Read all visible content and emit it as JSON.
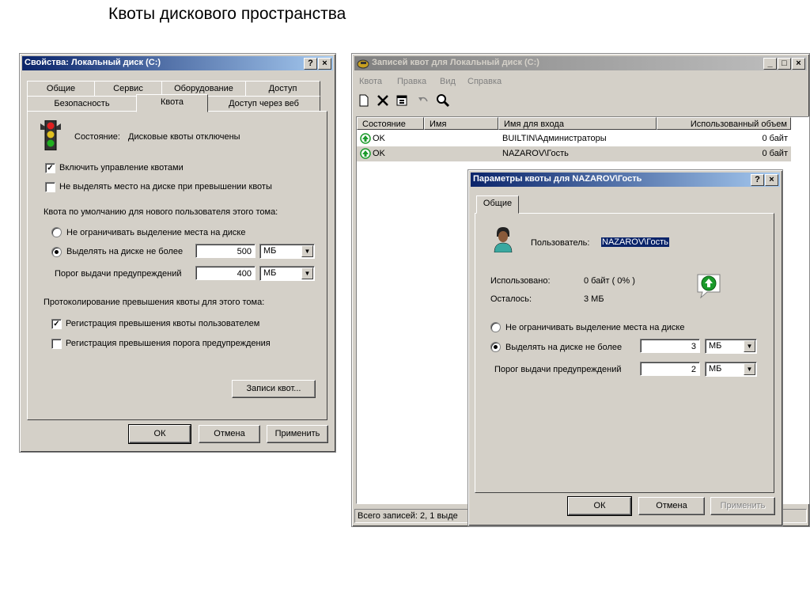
{
  "slide_title": "Квоты дискового пространства",
  "props": {
    "title": "Свойства: Локальный диск (C:)",
    "help_btn": "?",
    "close_btn": "×",
    "tabs_row1": [
      "Общие",
      "Сервис",
      "Оборудование",
      "Доступ"
    ],
    "tabs_row2": [
      "Безопасность",
      "Квота",
      "Доступ через веб"
    ],
    "status_label": "Состояние:",
    "status_text": "Дисковые квоты отключены",
    "enable_quota": "Включить управление квотами",
    "deny_space": "Не выделять место на диске при превышении квоты",
    "default_quota_label": "Квота по умолчанию для нового пользователя этого тома:",
    "no_limit": "Не ограничивать выделение места на диске",
    "limit_to": "Выделять на диске не более",
    "limit_value": "500",
    "limit_unit": "МБ",
    "warning_label": "Порог выдачи предупреждений",
    "warning_value": "400",
    "warning_unit": "МБ",
    "logging_label": "Протоколирование превышения квоты для этого тома:",
    "log_quota": "Регистрация превышения квоты пользователем",
    "log_warning": "Регистрация превышения порога предупреждения",
    "entries_btn": "Записи квот...",
    "ok": "ОК",
    "cancel": "Отмена",
    "apply": "Применить"
  },
  "entries": {
    "title": "Записей квот для Локальный диск (C:)",
    "min_btn": "_",
    "max_btn": "□",
    "close_btn": "×",
    "menu": [
      "Квота",
      "Правка",
      "Вид",
      "Справка"
    ],
    "columns": [
      "Состояние",
      "Имя",
      "Имя для входа",
      "Использованный объем"
    ],
    "rows": [
      {
        "status": "OK",
        "name": "",
        "login": "BUILTIN\\Администраторы",
        "used": "0 байт"
      },
      {
        "status": "OK",
        "name": "",
        "login": "NAZAROV\\Гость",
        "used": "0 байт"
      }
    ],
    "statusbar": "Всего записей: 2, 1 выде"
  },
  "params": {
    "title": "Параметры квоты для NAZAROV\\Гость",
    "help_btn": "?",
    "close_btn": "×",
    "tab": "Общие",
    "user_label": "Пользователь:",
    "user_value": "NAZAROV\\Гость",
    "used_label": "Использовано:",
    "used_value": "0 байт ( 0% )",
    "left_label": "Осталось:",
    "left_value": "3 МБ",
    "no_limit": "Не ограничивать выделение места на диске",
    "limit_to": "Выделять на диске не более",
    "limit_value": "3",
    "limit_unit": "МБ",
    "warning_label": "Порог выдачи предупреждений",
    "warning_value": "2",
    "warning_unit": "МБ",
    "ok": "ОК",
    "cancel": "Отмена",
    "apply": "Применить"
  },
  "colors": {
    "title_active": "#0a246a",
    "title_inactive": "#808080",
    "dialog_bg": "#d4d0c8",
    "ok_icon": "#1a9a2a"
  }
}
